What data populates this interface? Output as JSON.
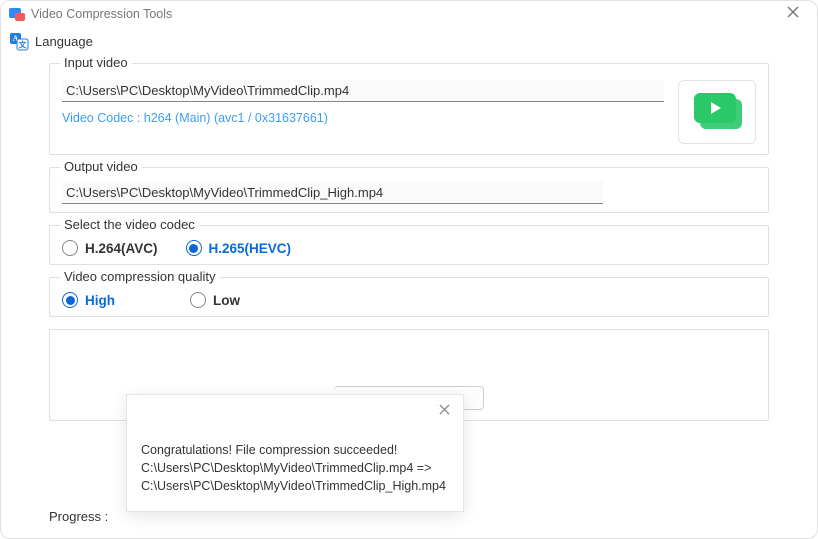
{
  "window": {
    "title": "Video Compression Tools"
  },
  "language": {
    "label": "Language"
  },
  "input_video": {
    "legend": "Input video",
    "path": "C:\\Users\\PC\\Desktop\\MyVideo\\TrimmedClip.mp4",
    "codec_info": "Video Codec : h264 (Main) (avc1 / 0x31637661)"
  },
  "output_video": {
    "legend": "Output video",
    "path": "C:\\Users\\PC\\Desktop\\MyVideo\\TrimmedClip_High.mp4"
  },
  "codec": {
    "legend": "Select the video codec",
    "option_h264": "H.264(AVC)",
    "option_h265": "H.265(HEVC)",
    "selected": "h265"
  },
  "quality": {
    "legend": "Video compression quality",
    "option_high": "High",
    "option_low": "Low",
    "selected": "high"
  },
  "progress": {
    "label": "Progress :"
  },
  "popup": {
    "line1": "Congratulations! File compression succeeded!",
    "line2": " C:\\Users\\PC\\Desktop\\MyVideo\\TrimmedClip.mp4 =>",
    "line3": "C:\\Users\\PC\\Desktop\\MyVideo\\TrimmedClip_High.mp4"
  }
}
